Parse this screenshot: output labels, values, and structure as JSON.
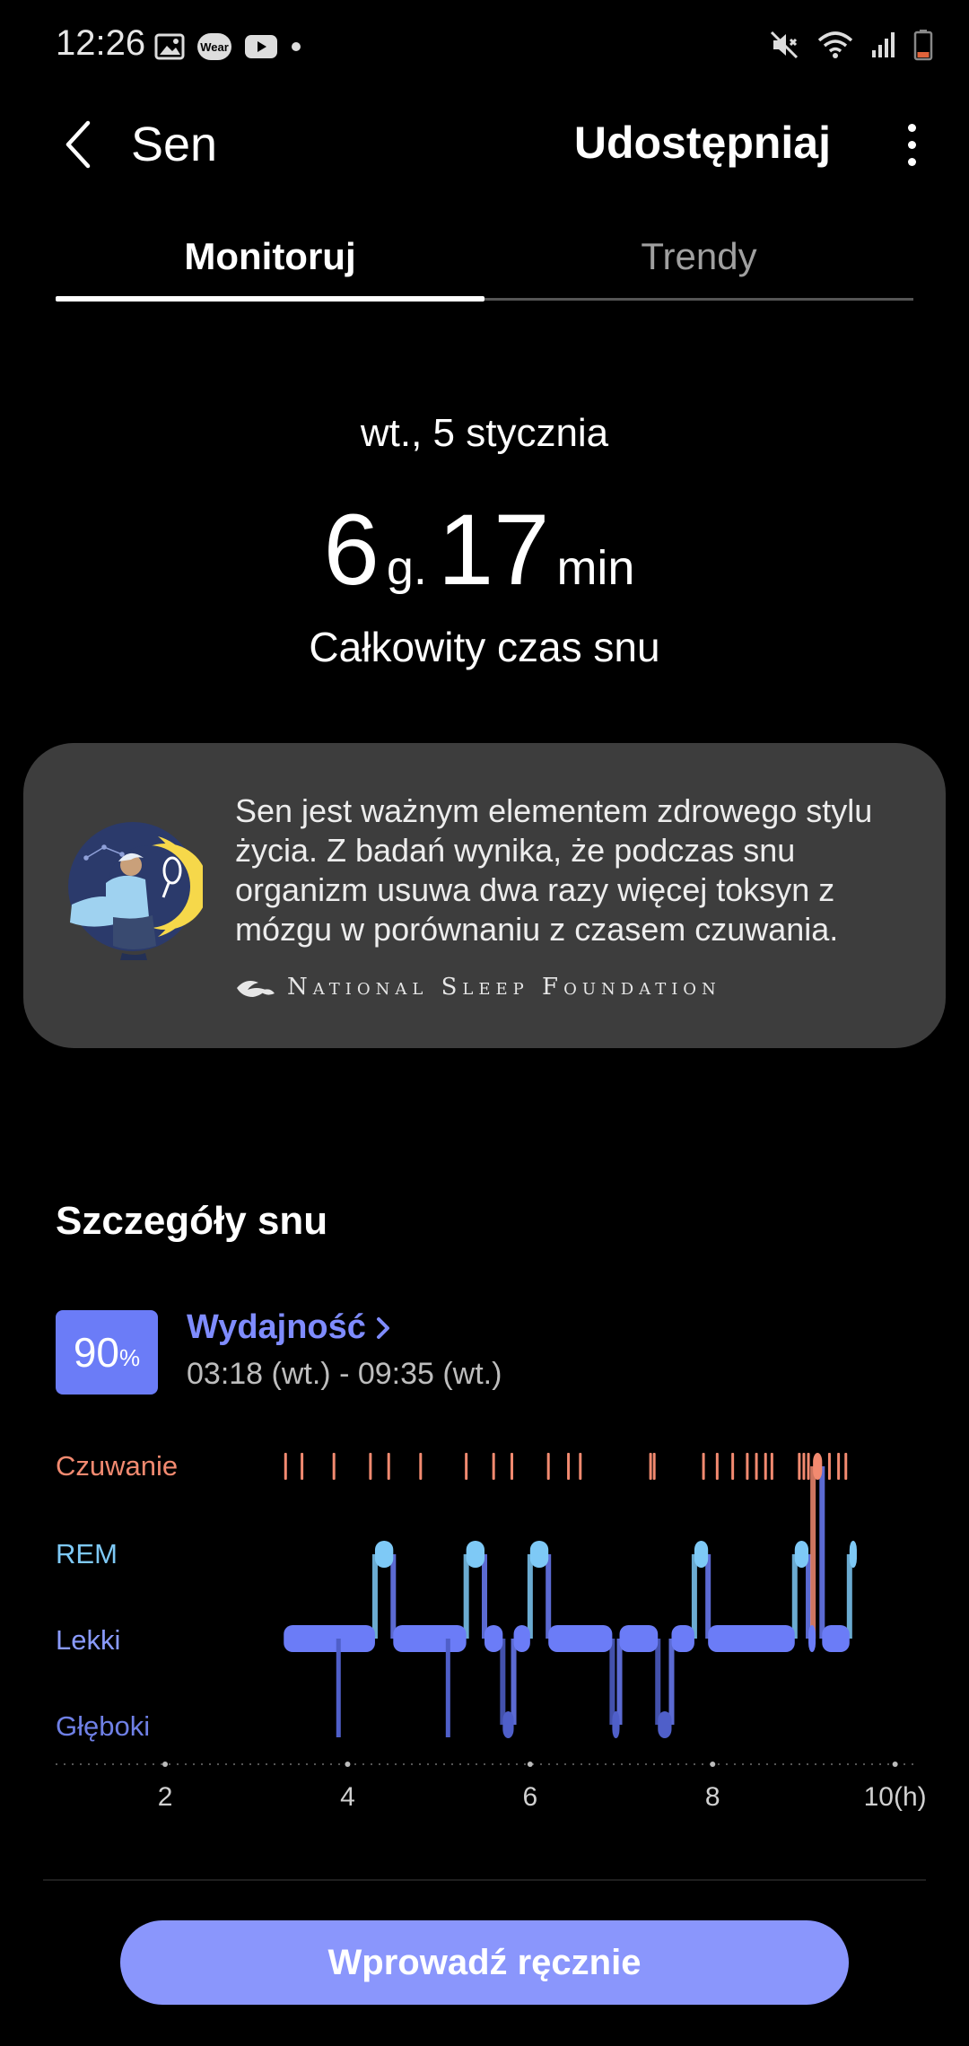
{
  "status_bar": {
    "time": "12:26",
    "left_icons": [
      "gallery-icon",
      "wear-icon",
      "youtube-icon",
      "dot-icon"
    ],
    "right_icons": [
      "mute-icon",
      "wifi-icon",
      "signal-icon",
      "battery-low-icon"
    ],
    "wear_label": "Wear"
  },
  "app_bar": {
    "title": "Sen",
    "share_label": "Udostępniaj"
  },
  "tabs": [
    {
      "label": "Monitoruj",
      "selected": true
    },
    {
      "label": "Trendy",
      "selected": false
    }
  ],
  "summary": {
    "date": "wt., 5 stycznia",
    "hours": "6",
    "hours_unit": "g.",
    "minutes": "17",
    "minutes_unit": "min",
    "label": "Całkowity czas snu"
  },
  "info_card": {
    "text": "Sen jest ważnym elementem zdrowego stylu życia. Z badań wynika, że podczas snu organizm usuwa dwa razy więcej toksyn z mózgu w porównaniu z czasem czuwania.",
    "source": "National Sleep Foundation"
  },
  "details": {
    "title": "Szczegóły snu",
    "efficiency_value": "90",
    "efficiency_unit": "%",
    "efficiency_label": "Wydajność",
    "time_range": "03:18 (wt.) - 09:35 (wt.)",
    "stage_labels": {
      "awake": "Czuwanie",
      "rem": "REM",
      "light": "Lekki",
      "deep": "Głęboki"
    },
    "axis_ticks": [
      "2",
      "4",
      "6",
      "8",
      "10(h)"
    ]
  },
  "colors": {
    "awake": "#f28a70",
    "rem": "#7ec9f6",
    "light": "#6b7cf7",
    "deep": "#4f5fc9",
    "button": "#8a96fc",
    "card": "#3d3d3d"
  },
  "chart_data": {
    "type": "hypnogram",
    "x_unit": "h",
    "xlim": [
      0.8,
      10.2
    ],
    "x_ticks": [
      2,
      4,
      6,
      8,
      10
    ],
    "levels": [
      "Czuwanie",
      "REM",
      "Lekki",
      "Głęboki"
    ],
    "segments": [
      {
        "stage": "Lekki",
        "start": 3.3,
        "end": 4.3
      },
      {
        "stage": "REM",
        "start": 4.3,
        "end": 4.5
      },
      {
        "stage": "Lekki",
        "start": 4.5,
        "end": 5.3
      },
      {
        "stage": "REM",
        "start": 5.3,
        "end": 5.5
      },
      {
        "stage": "Lekki",
        "start": 5.5,
        "end": 5.7
      },
      {
        "stage": "Głęboki",
        "start": 5.7,
        "end": 5.82
      },
      {
        "stage": "Lekki",
        "start": 5.82,
        "end": 6.0
      },
      {
        "stage": "REM",
        "start": 6.0,
        "end": 6.2
      },
      {
        "stage": "Lekki",
        "start": 6.2,
        "end": 6.9
      },
      {
        "stage": "Głęboki",
        "start": 6.9,
        "end": 6.98
      },
      {
        "stage": "Lekki",
        "start": 6.98,
        "end": 7.4
      },
      {
        "stage": "Głęboki",
        "start": 7.4,
        "end": 7.55
      },
      {
        "stage": "Lekki",
        "start": 7.55,
        "end": 7.8
      },
      {
        "stage": "REM",
        "start": 7.8,
        "end": 7.95
      },
      {
        "stage": "Lekki",
        "start": 7.95,
        "end": 8.9
      },
      {
        "stage": "REM",
        "start": 8.9,
        "end": 9.05
      },
      {
        "stage": "Lekki",
        "start": 9.05,
        "end": 9.1
      },
      {
        "stage": "Czuwanie",
        "start": 9.1,
        "end": 9.2
      },
      {
        "stage": "Lekki",
        "start": 9.2,
        "end": 9.5
      },
      {
        "stage": "REM",
        "start": 9.5,
        "end": 9.58
      }
    ],
    "deep_spikes": [
      3.9,
      5.1
    ],
    "awake_ticks": [
      3.32,
      3.5,
      3.85,
      4.25,
      4.45,
      4.8,
      5.3,
      5.6,
      5.8,
      6.2,
      6.42,
      6.55,
      7.32,
      7.36,
      7.9,
      8.05,
      8.22,
      8.38,
      8.48,
      8.58,
      8.65,
      8.95,
      9.0,
      9.05,
      9.28,
      9.38,
      9.46
    ]
  }
}
